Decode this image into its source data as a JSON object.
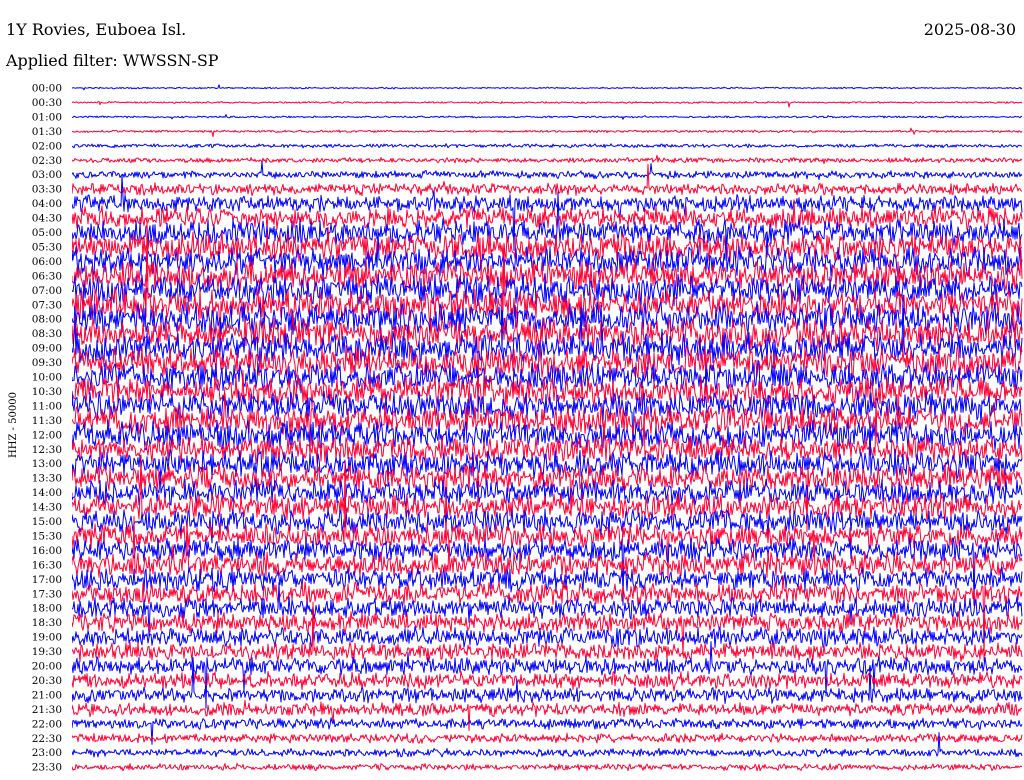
{
  "chart_data": {
    "type": "line",
    "title": "1Y Rovies, Euboea Isl.",
    "subtitle": "Applied filter: WWSSN-SP",
    "date": "2025-08-30",
    "ylabel": "HHZ - 50000",
    "xlabel": "",
    "series_colors": [
      "#0000ff",
      "#ff0033"
    ],
    "grid": false,
    "y_tick_labels": [
      "00:00",
      "00:30",
      "01:00",
      "01:30",
      "02:00",
      "02:30",
      "03:00",
      "03:30",
      "04:00",
      "04:30",
      "05:00",
      "05:30",
      "06:00",
      "06:30",
      "07:00",
      "07:30",
      "08:00",
      "08:30",
      "09:00",
      "09:30",
      "10:00",
      "10:30",
      "11:00",
      "11:30",
      "12:00",
      "12:30",
      "13:00",
      "13:30",
      "14:00",
      "14:30",
      "15:00",
      "15:30",
      "16:00",
      "16:30",
      "17:00",
      "17:30",
      "18:00",
      "18:30",
      "19:00",
      "19:30",
      "20:00",
      "20:30",
      "21:00",
      "21:30",
      "22:00",
      "22:30",
      "23:00",
      "23:30"
    ],
    "trace_relative_amplitude": [
      0.18,
      0.22,
      0.22,
      0.28,
      0.45,
      0.6,
      0.9,
      1.4,
      2.0,
      2.6,
      3.0,
      3.2,
      3.4,
      3.5,
      3.6,
      3.6,
      3.7,
      3.7,
      3.6,
      3.6,
      3.5,
      3.5,
      3.4,
      3.3,
      3.3,
      3.2,
      3.2,
      3.1,
      3.0,
      3.0,
      2.9,
      2.9,
      2.8,
      2.8,
      2.7,
      2.6,
      2.5,
      2.4,
      2.3,
      2.2,
      2.1,
      2.0,
      1.8,
      1.6,
      1.3,
      1.1,
      0.95,
      0.8
    ]
  }
}
